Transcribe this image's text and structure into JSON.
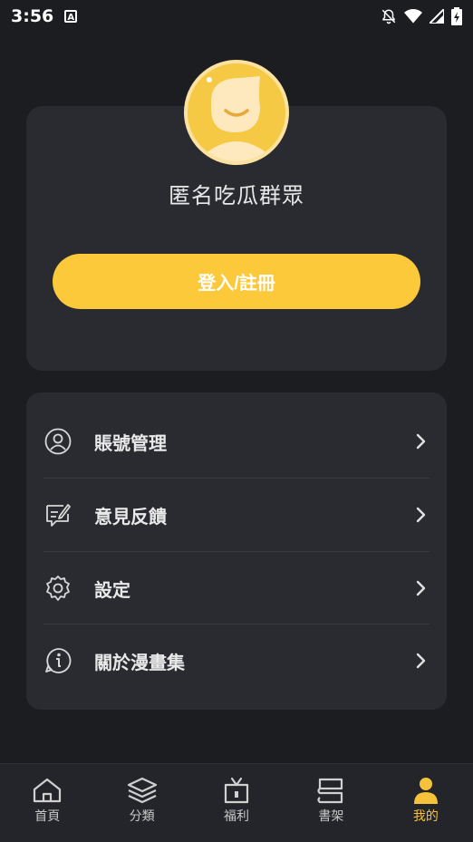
{
  "status_bar": {
    "time": "3:56",
    "icons": [
      "a-icon",
      "bell-off-icon",
      "wifi-icon",
      "signal-icon",
      "battery-icon"
    ]
  },
  "profile": {
    "nickname": "匿名吃瓜群眾",
    "login_button": "登入/註冊",
    "avatar_icon": "smiley-avatar-icon"
  },
  "menu": {
    "items": [
      {
        "label": "賬號管理",
        "icon": "user-circle-icon"
      },
      {
        "label": "意見反饋",
        "icon": "feedback-icon"
      },
      {
        "label": "設定",
        "icon": "gear-icon"
      },
      {
        "label": "關於漫畫集",
        "icon": "info-icon"
      }
    ]
  },
  "tabs": [
    {
      "label": "首頁",
      "icon": "home-icon"
    },
    {
      "label": "分類",
      "icon": "layers-icon"
    },
    {
      "label": "福利",
      "icon": "gift-icon"
    },
    {
      "label": "書架",
      "icon": "bookshelf-icon"
    },
    {
      "label": "我的",
      "icon": "person-icon",
      "active": true
    }
  ],
  "colors": {
    "background": "#1c1d20",
    "card": "#2a2b30",
    "accent": "#fcc93b"
  }
}
